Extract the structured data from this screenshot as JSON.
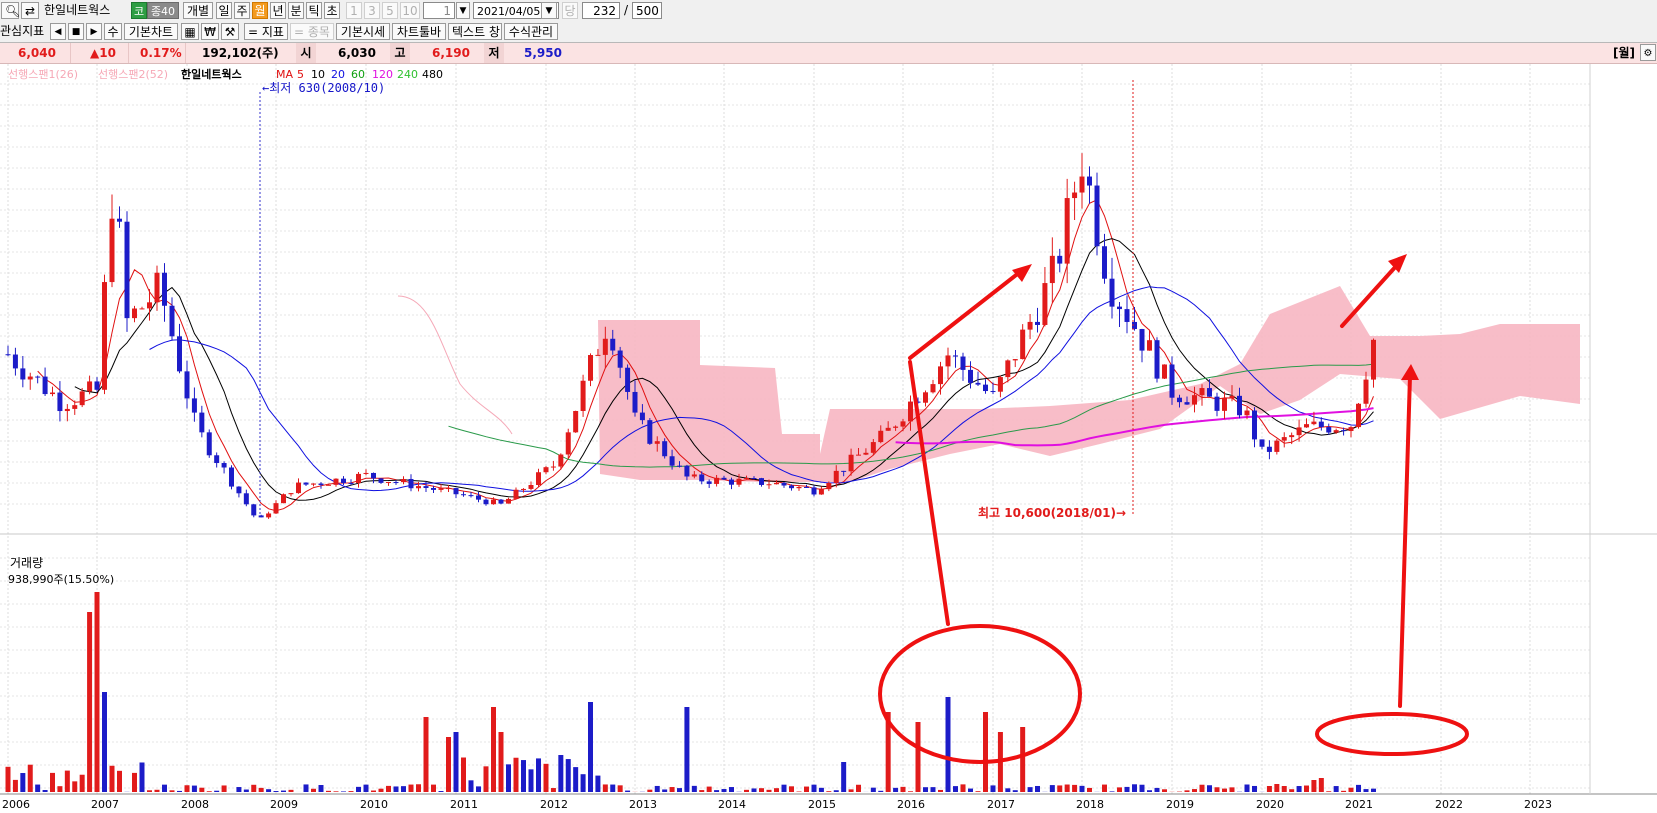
{
  "toolbar1": {
    "stock_name": "한일네트웍스",
    "market_badge": "코",
    "group_badge": "종40",
    "individual_label": "개별",
    "period_tabs": [
      "일",
      "주",
      "월",
      "년",
      "분",
      "틱",
      "초"
    ],
    "active_period": "월",
    "interval_buttons": [
      "1",
      "3",
      "5",
      "10"
    ],
    "interval_value": "1",
    "date_value": "2021/04/05",
    "current_btn": "당",
    "count_value": "232",
    "slash": "/",
    "total_value": "500"
  },
  "toolbar2": {
    "interest_label": "관심지표",
    "su_label": "수",
    "basic_chart_label": "기본차트",
    "won_label": "₩",
    "indicator_label": "= 지표",
    "stock_label": "= 종목",
    "basic_quote_label": "기본시세",
    "chart_toolbar_label": "차트툴바",
    "text_label": "텍스트 창",
    "formula_label": "수식관리"
  },
  "quote": {
    "price": "6,040",
    "change": "▲10",
    "change_pct": "0.17%",
    "volume": "192,102(주)",
    "open_label": "시",
    "open": "6,030",
    "high_label": "고",
    "high": "6,190",
    "low_label": "저",
    "low": "5,950",
    "period_label": "[월]"
  },
  "legend": {
    "span1": "선행스팬1(26)",
    "span2": "선행스팬2(52)",
    "stock": "한일네트웍스",
    "ma_label": "MA",
    "ma_periods": [
      "5",
      "10",
      "20",
      "60",
      "120",
      "240",
      "480"
    ],
    "ma_colors": [
      "#e01010",
      "#000000",
      "#1010e0",
      "#10a010",
      "#e010e0",
      "#30c030",
      "#000000"
    ]
  },
  "annotations": {
    "low_marker": "←최저 630(2008/10)",
    "high_marker": "최고 10,600(2018/01)→"
  },
  "volume_panel": {
    "title": "거래량",
    "value": "938,990주(15.50%)"
  },
  "colors": {
    "up": "#e11b1b",
    "down": "#1c1cc8",
    "cloud": "#f7b6c2"
  },
  "chart_data": [
    {
      "type": "candlestick",
      "title": "한일네트웍스",
      "x_tick_labels": [
        "2006",
        "2007",
        "2008",
        "2009",
        "2010",
        "2011",
        "2012",
        "2013",
        "2014",
        "2015",
        "2016",
        "2017",
        "2018",
        "2019",
        "2020",
        "2021",
        "2022",
        "2023"
      ],
      "x_unit": "monthly candles",
      "ylim": [
        500,
        12000
      ],
      "low_point": {
        "label": "2008/10",
        "value": 630
      },
      "high_point": {
        "label": "2018/01",
        "value": 10600
      },
      "last_candle": {
        "open": 6030,
        "high": 6190,
        "low": 5950,
        "close": 6040
      },
      "moving_averages": [
        "5",
        "10",
        "20",
        "60",
        "120",
        "240",
        "480"
      ]
    },
    {
      "type": "bar",
      "title": "거래량",
      "x_tick_labels": [
        "2006",
        "2007",
        "2008",
        "2009",
        "2010",
        "2011",
        "2012",
        "2013",
        "2014",
        "2015",
        "2016",
        "2017",
        "2018",
        "2019",
        "2020",
        "2021",
        "2022",
        "2023"
      ],
      "last_value": "938,990주(15.50%)"
    }
  ]
}
